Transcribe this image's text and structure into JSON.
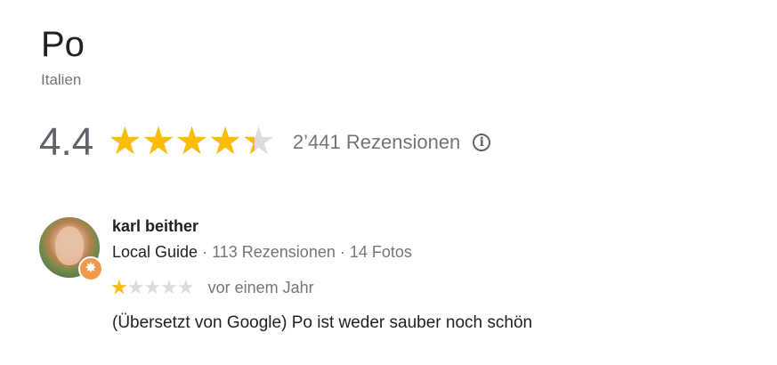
{
  "place": {
    "title": "Po",
    "subtitle": "Italien"
  },
  "rating": {
    "value_text": "4.4",
    "value": 4.4,
    "max": 5,
    "reviews_text": "2’441 Rezensionen",
    "info_icon": "info-icon"
  },
  "review": {
    "reviewer_name": "karl beither",
    "guide_label": "Local Guide",
    "separator": " · ",
    "reviews_count_text": "113 Rezensionen",
    "photos_count_text": "14 Fotos",
    "stars": 1,
    "max_stars": 5,
    "date": "vor einem Jahr",
    "text": "(Übersetzt von Google) Po ist weder sauber noch schön",
    "badge_icon": "local-guide-star-icon",
    "avatar_icon": "reviewer-avatar"
  },
  "colors": {
    "star_fill": "#fbbc04",
    "star_empty": "#dadce0",
    "secondary_text": "#70757a",
    "badge": "#f09a4b"
  }
}
